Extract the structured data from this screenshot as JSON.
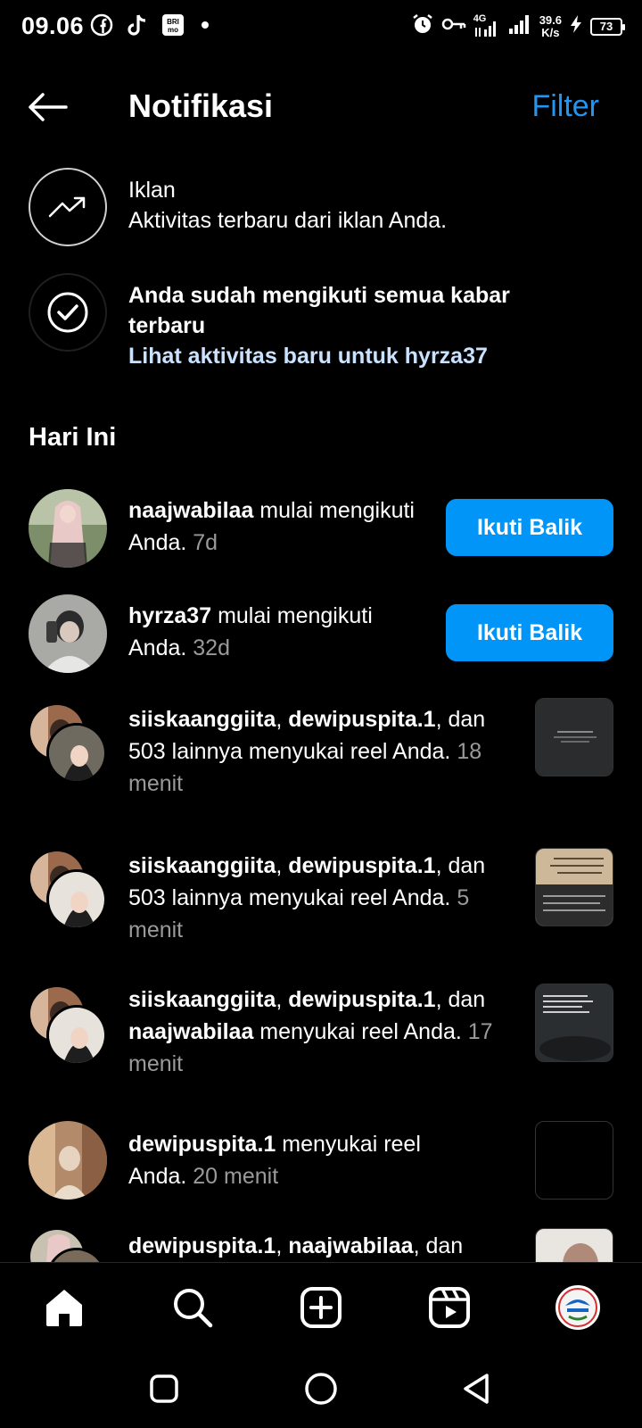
{
  "status_bar": {
    "time": "09.06",
    "network": "4G",
    "speed_value": "39.6",
    "speed_unit": "K/s",
    "battery": "73"
  },
  "header": {
    "title": "Notifikasi",
    "filter_label": "Filter"
  },
  "ads_row": {
    "title": "Iklan",
    "subtitle": "Aktivitas terbaru dari iklan Anda."
  },
  "caught_up_row": {
    "title": "Anda sudah mengikuti semua kabar terbaru",
    "link": "Lihat aktivitas baru untuk hyrza37"
  },
  "section": {
    "today": "Hari Ini"
  },
  "notifications": [
    {
      "user": "naajwabilaa",
      "text": " mulai mengikuti Anda. ",
      "time": "7d",
      "button": "Ikuti Balik"
    },
    {
      "user": "hyrza37",
      "text": " mulai mengikuti Anda. ",
      "time": "32d",
      "button": "Ikuti Balik"
    },
    {
      "user1": "siiskaanggiita",
      "sep": ", ",
      "user2": "dewipuspita.1",
      "text": ", dan 503 lainnya menyukai reel Anda. ",
      "time": "18 menit"
    },
    {
      "user1": "siiskaanggiita",
      "sep": ", ",
      "user2": "dewipuspita.1",
      "text": ", dan 503 lainnya menyukai reel Anda. ",
      "time": "5 menit"
    },
    {
      "user1": "siiskaanggiita",
      "sep": ", ",
      "user2": "dewipuspita.1",
      "text_mid": ", dan ",
      "user3": "naajwabilaa",
      "text": " menyukai reel Anda. ",
      "time": "17 menit"
    },
    {
      "user": "dewipuspita.1",
      "text": " menyukai reel Anda. ",
      "time": "20 menit"
    },
    {
      "user1": "dewipuspita.1",
      "sep": ", ",
      "user2": "naajwabilaa",
      "text": ", dan"
    }
  ],
  "colors": {
    "accent": "#0095f6",
    "filter": "#2196f3",
    "link": "#c9e2ff",
    "muted": "#9a9a9a"
  }
}
